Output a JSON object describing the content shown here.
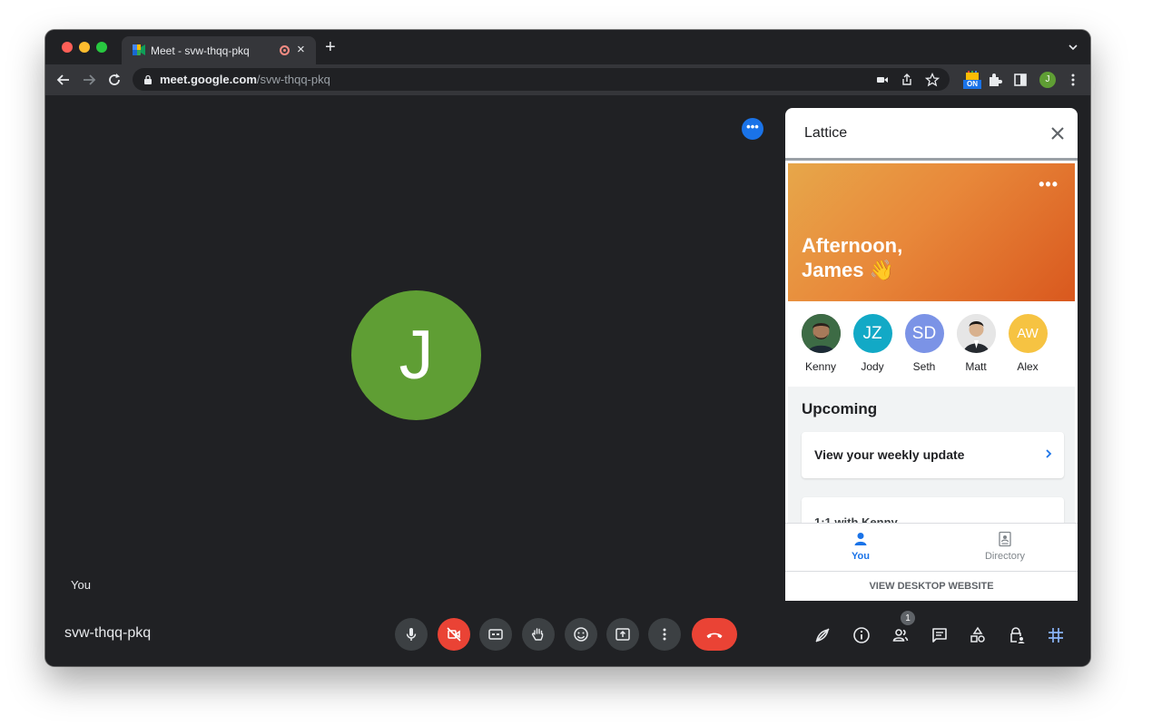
{
  "browser": {
    "tab_title": "Meet - svw-thqq-pkq",
    "tab_close": "×",
    "new_tab": "+",
    "url_host": "meet.google.com",
    "url_path": "/svw-thqq-pkq",
    "extension_badge": "ON",
    "profile_initial": "J"
  },
  "meet": {
    "more_label": "•••",
    "avatar_initial": "J",
    "self_label": "You",
    "meeting_code": "svw-thqq-pkq",
    "participant_count": "1",
    "colors": {
      "background": "#202124",
      "control": "#3c4043",
      "danger": "#ea4335",
      "avatar": "#5f9e34",
      "accent": "#1a73e8",
      "activities": "#8ab4f8"
    }
  },
  "panel": {
    "title": "Lattice",
    "greeting_line1": "Afternoon,",
    "greeting_line2": "James 👋",
    "greeting_more": "•••",
    "people": [
      {
        "name": "Kenny",
        "initials": "",
        "color": "#4a3b30"
      },
      {
        "name": "Jody",
        "initials": "JZ",
        "color": "#12a9c6"
      },
      {
        "name": "Seth",
        "initials": "SD",
        "color": "#7b93e6"
      },
      {
        "name": "Matt",
        "initials": "",
        "color": "#d9d9d9"
      },
      {
        "name": "Alex",
        "initials": "AW",
        "color": "#f6c342"
      }
    ],
    "upcoming_title": "Upcoming",
    "weekly_update": "View your weekly update",
    "one_on_one": "1:1 with  Kenny",
    "tabs": {
      "you": "You",
      "directory": "Directory"
    },
    "footer": "VIEW DESKTOP WEBSITE"
  }
}
